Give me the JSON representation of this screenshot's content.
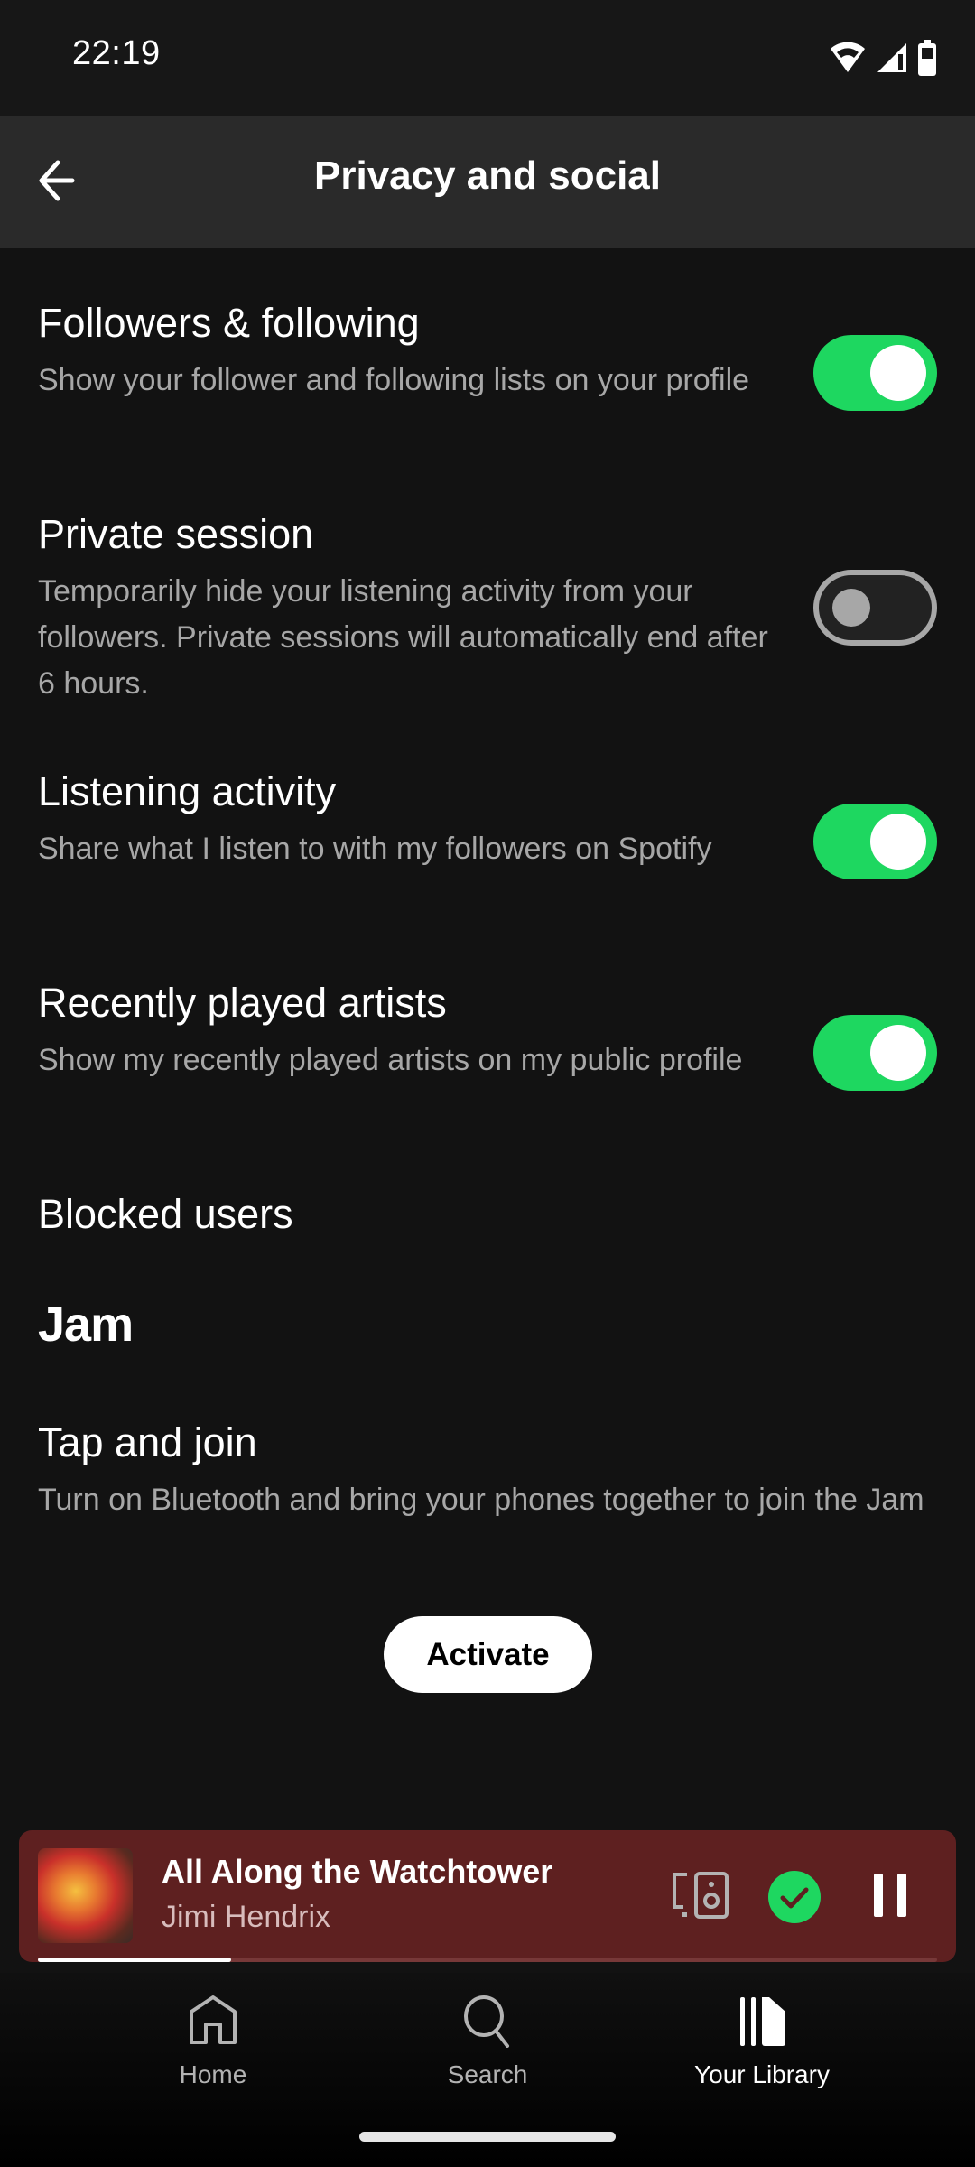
{
  "status_bar": {
    "time": "22:19",
    "icons": [
      "wifi-icon",
      "cell-signal-icon",
      "battery-icon"
    ]
  },
  "header": {
    "title": "Privacy and social",
    "back_icon": "arrow-left-icon"
  },
  "settings": [
    {
      "title": "Followers & following",
      "description": "Show your follower and following lists on your profile",
      "enabled": true
    },
    {
      "title": "Private session",
      "description": "Temporarily hide your listening activity from your followers. Private sessions will automatically end after 6 hours.",
      "enabled": false
    },
    {
      "title": "Listening activity",
      "description": "Share what I listen to with my followers on Spotify",
      "enabled": true
    },
    {
      "title": "Recently played artists",
      "description": "Show my recently played artists on my public profile",
      "enabled": true
    }
  ],
  "blocked_users": {
    "label": "Blocked users"
  },
  "jam": {
    "section_title": "Jam",
    "tap_and_join": {
      "title": "Tap and join",
      "description": "Turn on Bluetooth and bring your phones together to join the Jam",
      "button_label": "Activate"
    }
  },
  "now_playing": {
    "song": "All Along the Watchtower",
    "artist": "Jimi Hendrix",
    "progress_percent": 21.5,
    "background_color": "#5e2020",
    "icons": [
      "devices-icon",
      "saved-check-icon",
      "pause-icon"
    ]
  },
  "bottom_nav": {
    "items": [
      {
        "label": "Home",
        "icon": "home-icon",
        "active": false
      },
      {
        "label": "Search",
        "icon": "search-icon",
        "active": false
      },
      {
        "label": "Your Library",
        "icon": "library-icon",
        "active": true
      }
    ]
  },
  "colors": {
    "accent": "#1ed760",
    "background": "#121212",
    "header": "#2a2a2a",
    "secondary_text": "#a7a7a7"
  }
}
